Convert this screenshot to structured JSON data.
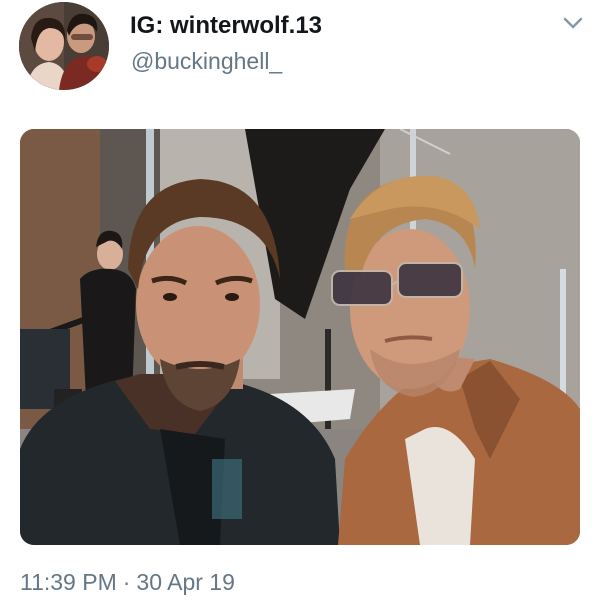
{
  "author": {
    "display_name": "IG: winterwolf.13",
    "handle": "@buckinghell_",
    "avatar_icon": "avatar-photo"
  },
  "menu": {
    "icon": "chevron-down-icon"
  },
  "media": {
    "type": "photo"
  },
  "meta": {
    "time": "11:39 PM",
    "separator": "·",
    "date": "30 Apr 19"
  },
  "colors": {
    "name": "#14171a",
    "secondary": "#657786",
    "background": "#ffffff"
  }
}
